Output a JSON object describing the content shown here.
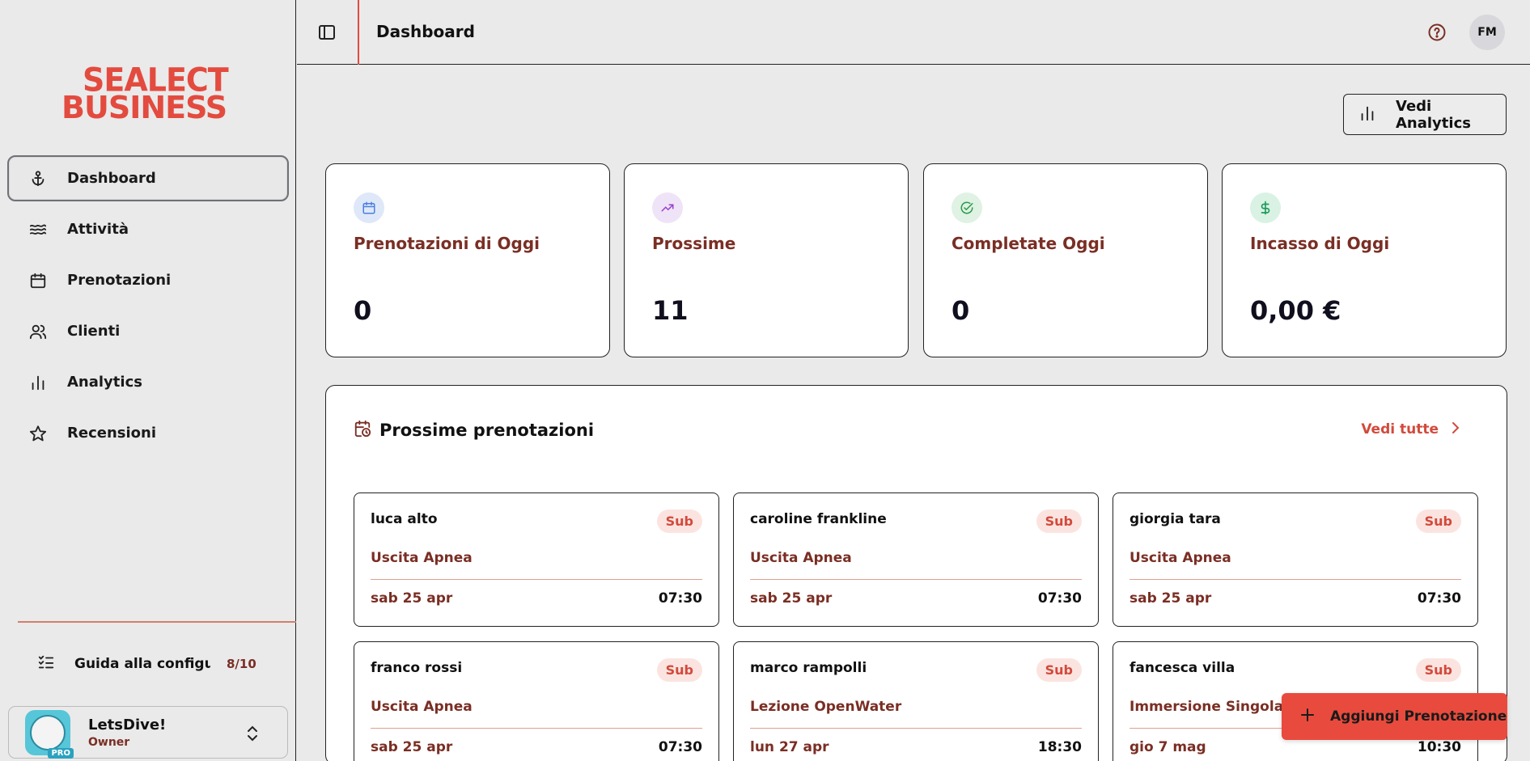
{
  "brand": {
    "line1": "SEALECT",
    "line2": "BUSINESS",
    "accent": "#e34b3f"
  },
  "sidebar": {
    "items": [
      {
        "label": "Dashboard",
        "icon": "anchor-icon"
      },
      {
        "label": "Attività",
        "icon": "waves-icon"
      },
      {
        "label": "Prenotazioni",
        "icon": "calendar-icon"
      },
      {
        "label": "Clienti",
        "icon": "users-icon"
      },
      {
        "label": "Analytics",
        "icon": "bar-chart-icon"
      },
      {
        "label": "Recensioni",
        "icon": "star-icon"
      }
    ],
    "guide": {
      "label": "Guida alla configu…",
      "count": "8/10"
    },
    "org": {
      "name": "LetsDive!",
      "role": "Owner",
      "badge": "PRO"
    }
  },
  "header": {
    "title": "Dashboard",
    "avatar_initials": "FM"
  },
  "toolbar": {
    "analytics_label": "Vedi Analytics"
  },
  "stats": [
    {
      "title": "Prenotazioni di Oggi",
      "value": "0",
      "icon": "calendar-icon",
      "color": "#4a7fe0",
      "bg": "#dfe8f8"
    },
    {
      "title": "Prossime",
      "value": "11",
      "icon": "trending-up-icon",
      "color": "#9a3fd0",
      "bg": "#efe3f7"
    },
    {
      "title": "Completate Oggi",
      "value": "0",
      "icon": "check-circle-icon",
      "color": "#2a9a4a",
      "bg": "#dff2e3"
    },
    {
      "title": "Incasso di Oggi",
      "value": "0,00 €",
      "icon": "dollar-icon",
      "color": "#1f9a5a",
      "bg": "#d9f2e4"
    }
  ],
  "upcoming": {
    "title": "Prossime prenotazioni",
    "see_all": "Vedi tutte",
    "bookings": [
      {
        "name": "luca alto",
        "tag": "Sub",
        "activity": "Uscita Apnea",
        "date": "sab 25 apr",
        "time": "07:30"
      },
      {
        "name": "caroline frankline",
        "tag": "Sub",
        "activity": "Uscita Apnea",
        "date": "sab 25 apr",
        "time": "07:30"
      },
      {
        "name": "giorgia tara",
        "tag": "Sub",
        "activity": "Uscita Apnea",
        "date": "sab 25 apr",
        "time": "07:30"
      },
      {
        "name": "franco rossi",
        "tag": "Sub",
        "activity": "Uscita Apnea",
        "date": "sab 25 apr",
        "time": "07:30"
      },
      {
        "name": "marco rampolli",
        "tag": "Sub",
        "activity": "Lezione OpenWater",
        "date": "lun 27 apr",
        "time": "18:30"
      },
      {
        "name": "fancesca villa",
        "tag": "Sub",
        "activity": "Immersione Singola",
        "date": "gio 7 mag",
        "time": "10:30"
      }
    ]
  },
  "fab": {
    "label": "Aggiungi Prenotazione"
  }
}
